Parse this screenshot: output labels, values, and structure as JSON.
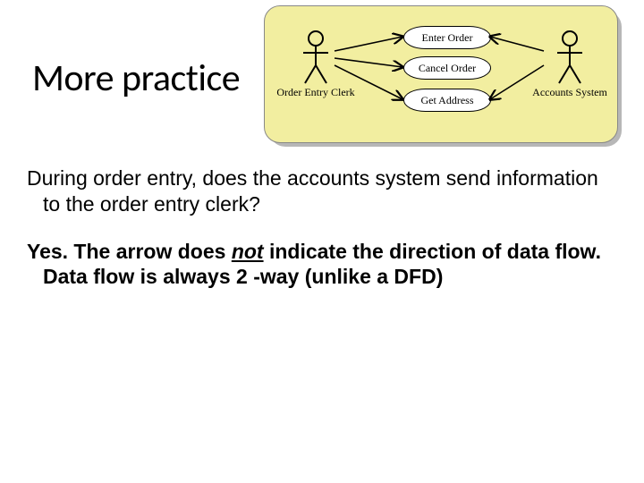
{
  "title": "More practice",
  "question": "During order entry, does the accounts system send information to the order entry clerk?",
  "answer_line1_pre": "Yes. The arrow does ",
  "answer_line1_not": "not",
  "answer_line1_post": " indicate the direction of data flow.",
  "answer_line2": "Data flow is always 2 -way (unlike a DFD)",
  "diagram": {
    "actor_left": "Order Entry Clerk",
    "actor_right": "Accounts System",
    "uc1": "Enter Order",
    "uc2": "Cancel Order",
    "uc3": "Get Address"
  }
}
